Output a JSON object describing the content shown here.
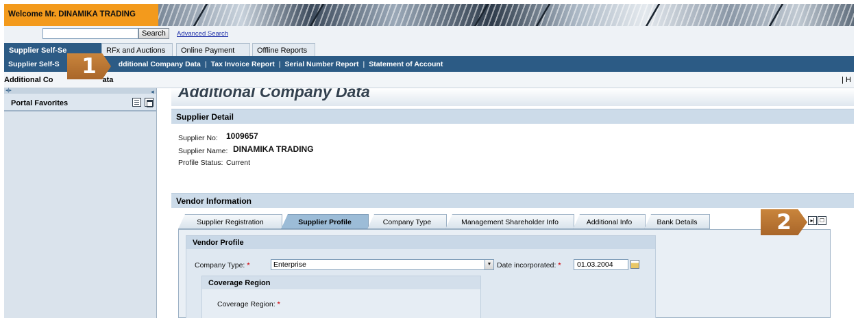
{
  "header": {
    "welcome": "Welcome Mr. DINAMIKA TRADING"
  },
  "search": {
    "value": "",
    "button": "Search",
    "advanced_link": "Advanced Search"
  },
  "top_tabs": [
    {
      "label": "Supplier Self-Se",
      "active": true
    },
    {
      "label": "RFx and Auctions",
      "active": false
    },
    {
      "label": "Online Payment",
      "active": false
    },
    {
      "label": "Offline Reports",
      "active": false
    }
  ],
  "subnav": {
    "items": [
      "Supplier Self-S",
      "dditional Company Data",
      "Tax Invoice Report",
      "Serial Number Report",
      "Statement of Account"
    ],
    "separator": "|"
  },
  "page_bar": {
    "title": "Additional Co",
    "title_tail": "ata",
    "right": "| H"
  },
  "left_panel": {
    "title": "Portal Favorites",
    "collapse": "◂|▸"
  },
  "main": {
    "big_title": "Additional Company Data",
    "supplier_detail": {
      "heading": "Supplier Detail",
      "supplier_no_label": "Supplier No:",
      "supplier_no": "1009657",
      "supplier_name_label": "Supplier Name:",
      "supplier_name": "DINAMIKA TRADING",
      "profile_status_label": "Profile Status:",
      "profile_status": "Current"
    },
    "vendor_information": {
      "heading": "Vendor Information",
      "tabs": [
        {
          "label": "Supplier Registration",
          "active": false
        },
        {
          "label": "Supplier Profile",
          "active": true
        },
        {
          "label": "Company Type",
          "active": false
        },
        {
          "label": "Management Shareholder Info",
          "active": false
        },
        {
          "label": "Additional Info",
          "active": false
        },
        {
          "label": "Bank Details",
          "active": false
        }
      ],
      "vendor_profile": {
        "heading": "Vendor Profile",
        "company_type_label": "Company Type:",
        "company_type_value": "Enterprise",
        "date_label": "Date incorporated:",
        "date_value": "01.03.2004",
        "required_mark": "*"
      },
      "coverage_region": {
        "heading": "Coverage Region",
        "label": "Coverage Region:"
      }
    }
  },
  "callouts": {
    "one": "1",
    "two": "2"
  },
  "colors": {
    "accent_orange": "#f39a1c",
    "nav_blue": "#2c5b85",
    "callout_brown": "#b87330",
    "required_red": "#d3242b"
  }
}
